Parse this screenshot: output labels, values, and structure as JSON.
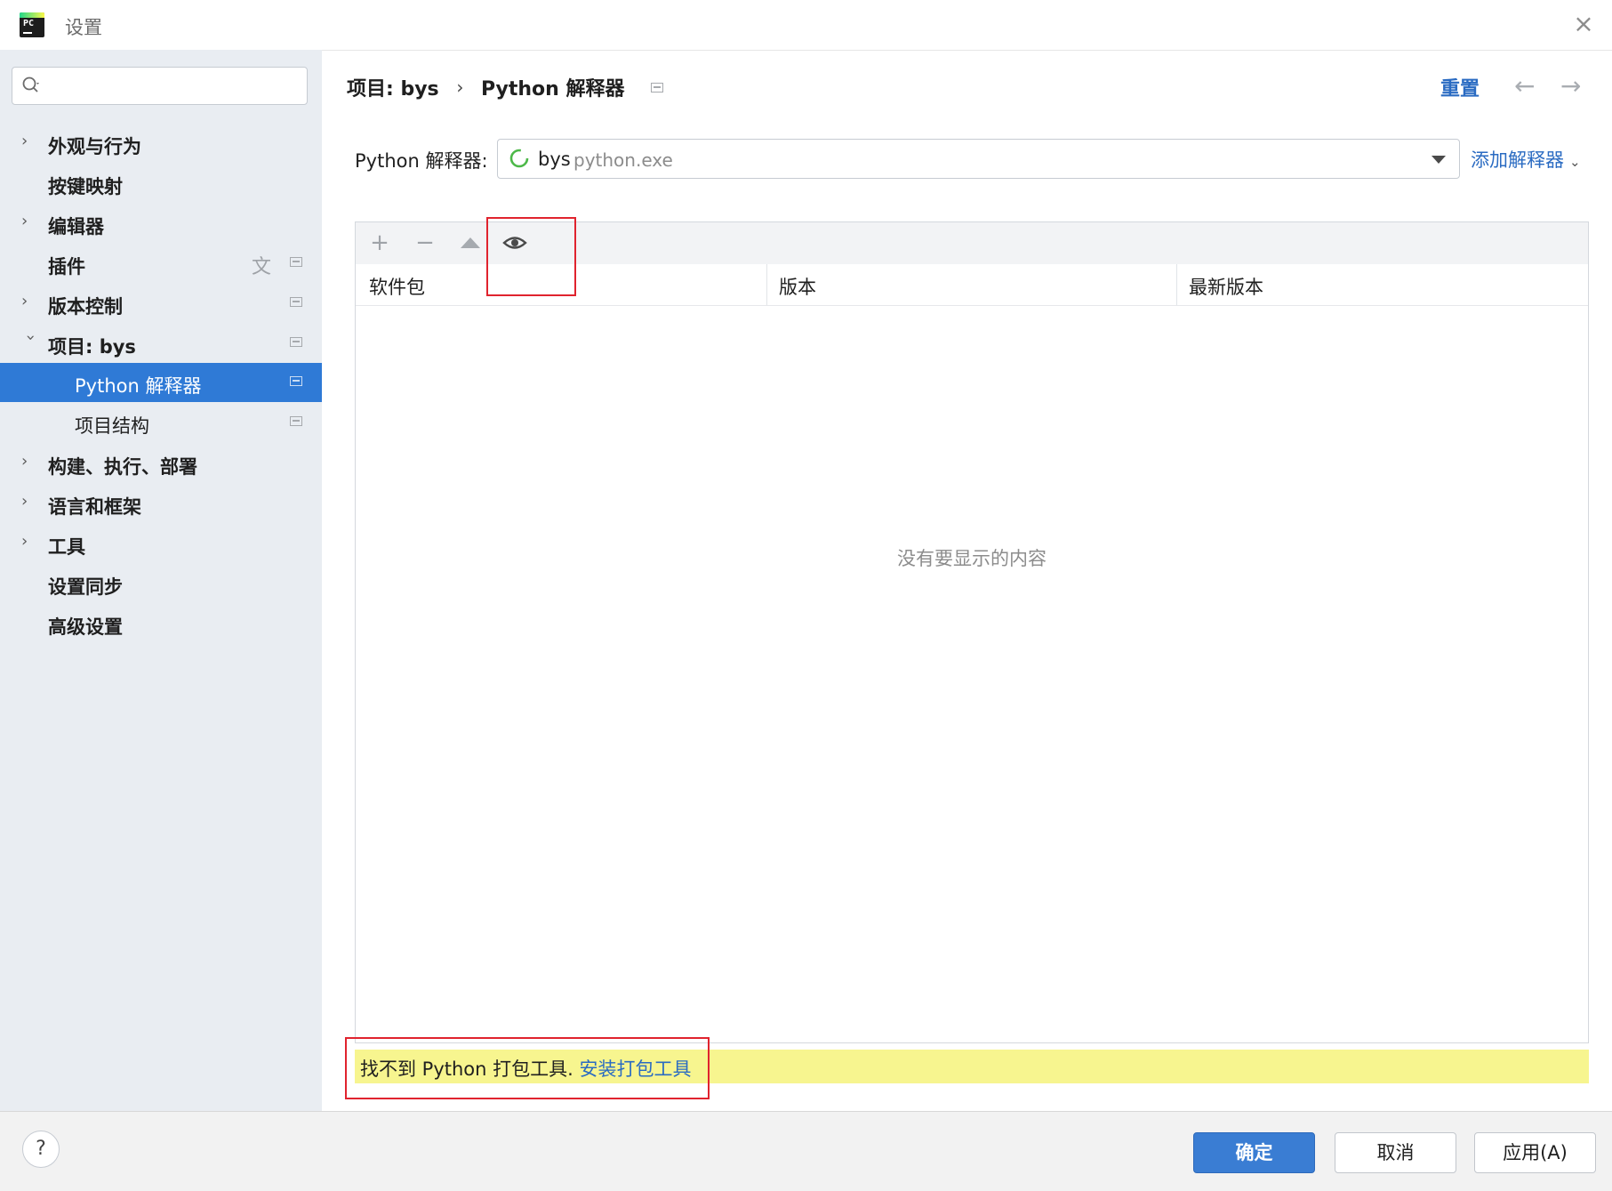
{
  "window": {
    "title": "设置",
    "close_icon": "close-icon"
  },
  "search": {
    "placeholder": "",
    "value": ""
  },
  "sidebar": {
    "items": [
      {
        "label": "外观与行为",
        "expandable": true
      },
      {
        "label": "按键映射",
        "expandable": false
      },
      {
        "label": "编辑器",
        "expandable": true
      },
      {
        "label": "插件",
        "expandable": false
      },
      {
        "label": "版本控制",
        "expandable": true
      },
      {
        "label": "项目: bys",
        "expandable": true,
        "expanded": true
      },
      {
        "label": "Python 解释器",
        "child": true,
        "selected": true
      },
      {
        "label": "项目结构",
        "child": true
      },
      {
        "label": "构建、执行、部署",
        "expandable": true
      },
      {
        "label": "语言和框架",
        "expandable": true
      },
      {
        "label": "工具",
        "expandable": true
      },
      {
        "label": "设置同步",
        "expandable": false
      },
      {
        "label": "高级设置",
        "expandable": false
      }
    ]
  },
  "breadcrumb": {
    "project": "项目: bys",
    "separator": "›",
    "page": "Python 解释器"
  },
  "header_actions": {
    "reset": "重置"
  },
  "interpreter": {
    "label": "Python 解释器:",
    "name": "bys",
    "path": "python.exe",
    "add_link": "添加解释器"
  },
  "packages": {
    "columns": [
      "软件包",
      "版本",
      "最新版本"
    ],
    "rows": [],
    "empty_text": "没有要显示的内容"
  },
  "warning": {
    "text": "找不到 Python 打包工具.",
    "link": "安装打包工具"
  },
  "footer": {
    "help": "?",
    "ok": "确定",
    "cancel": "取消",
    "apply": "应用(A)"
  },
  "colors": {
    "accent": "#2f7ad6",
    "link": "#2a6bc2",
    "warning_bg": "#f7f58f",
    "annotation": "#e0232e",
    "sidebar_bg": "#e9edf2"
  }
}
